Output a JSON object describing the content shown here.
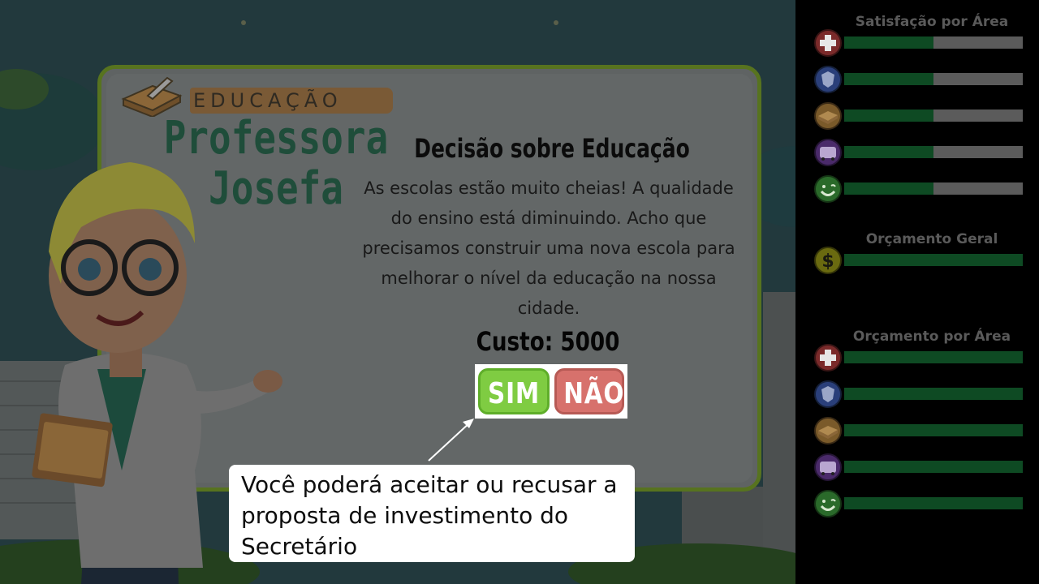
{
  "scene": {
    "category_label": "EDUCAÇÃO",
    "character_name_line1": "Professora",
    "character_name_line2": "Josefa",
    "decision_title": "Decisão sobre Educação",
    "decision_text": "As escolas estão muito cheias! A qualidade do ensino está diminuindo. Acho que precisamos construir uma nova escola para melhorar o nível da educação na nossa cidade.",
    "cost_label": "Custo: 5000",
    "yes_label": "SIM",
    "no_label": "NÃO",
    "tooltip_text": "Você poderá aceitar ou recusar a proposta de investimento do Secretário",
    "colors": {
      "yes": "#7fcc42",
      "no": "#d7716c",
      "bar_fill": "#0e4a23",
      "bar_track": "#5b5b5b"
    }
  },
  "panel": {
    "satisfaction": {
      "title": "Satisfação por Área",
      "bars": [
        {
          "area": "saude",
          "icon": "health-cross-icon",
          "level": 0.5
        },
        {
          "area": "seguranca",
          "icon": "police-badge-icon",
          "level": 0.5
        },
        {
          "area": "educacao",
          "icon": "book-icon",
          "level": 0.5
        },
        {
          "area": "transporte",
          "icon": "bus-icon",
          "level": 0.5
        },
        {
          "area": "lazer",
          "icon": "smiley-icon",
          "level": 0.5
        }
      ]
    },
    "general_budget": {
      "title": "Orçamento Geral",
      "icon": "dollar-icon",
      "level": 1.0
    },
    "area_budget": {
      "title": "Orçamento por Área",
      "bars": [
        {
          "area": "saude",
          "icon": "health-cross-icon",
          "level": 1.0
        },
        {
          "area": "seguranca",
          "icon": "police-badge-icon",
          "level": 1.0
        },
        {
          "area": "educacao",
          "icon": "book-icon",
          "level": 1.0
        },
        {
          "area": "transporte",
          "icon": "bus-icon",
          "level": 1.0
        },
        {
          "area": "lazer",
          "icon": "smiley-icon",
          "level": 1.0
        }
      ]
    }
  }
}
